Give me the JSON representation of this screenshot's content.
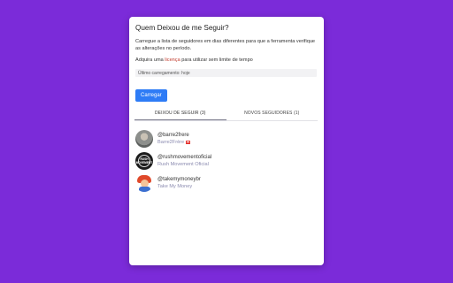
{
  "card": {
    "title": "Quem Deixou de me Seguir?",
    "description": "Carregue a lista de seguidores em dias diferentes para que a ferramenta verifique as alterações no período.",
    "license_prefix": "Adquira uma",
    "license_link": "licença",
    "license_suffix": "para utilizar sem limite de tempo",
    "last_load": "Último carregamento: hoje",
    "load_button": "Carregar"
  },
  "tabs": [
    {
      "label": "DEIXOU DE SEGUIR (3)",
      "active": true
    },
    {
      "label": "NOVOS SEGUIDORES (1)",
      "active": false
    }
  ],
  "users": [
    {
      "handle": "@barre2frere",
      "name": "Barre2Frère",
      "flag": true
    },
    {
      "handle": "@rushmovementoficial",
      "name": "Rush Movement Oficial",
      "flag": false
    },
    {
      "handle": "@takemymoneybr",
      "name": "Take My Money",
      "flag": false
    }
  ],
  "avatar_labels": {
    "rush": "RUSH MOVEMENT"
  },
  "colors": {
    "background": "#7b2bd9",
    "button": "#2e7cf6",
    "link": "#c0392b"
  }
}
